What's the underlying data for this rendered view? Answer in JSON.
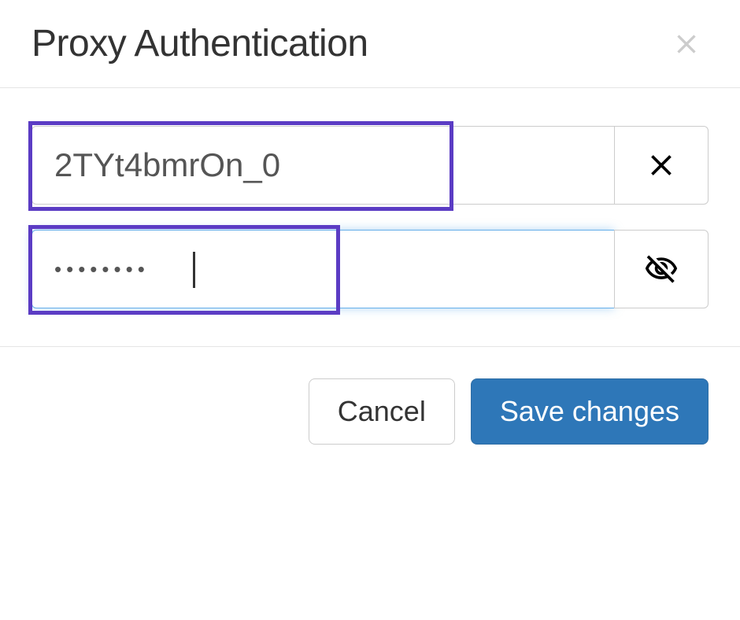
{
  "modal": {
    "title": "Proxy Authentication",
    "username_value": "2TYt4bmrOn_0",
    "password_value": "••••••••",
    "cancel_label": "Cancel",
    "save_label": "Save changes"
  },
  "colors": {
    "highlight": "#5b3cc4",
    "primary": "#2e77b8",
    "focus": "#66afe9"
  }
}
